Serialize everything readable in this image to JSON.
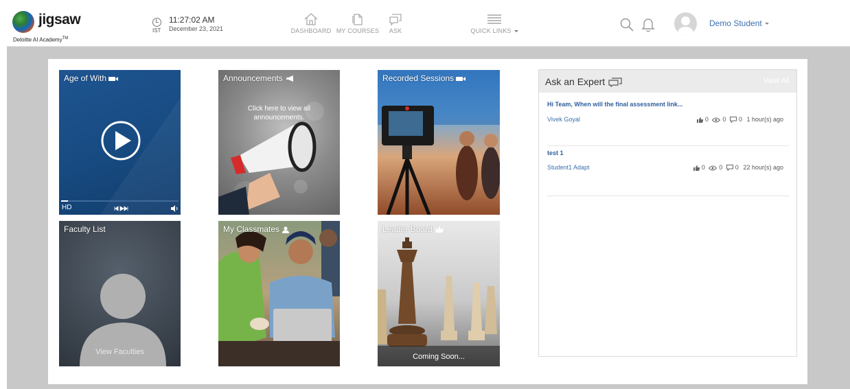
{
  "brand": {
    "name": "jigsaw",
    "tagline": "Deloitte AI Academy",
    "trademark": "TM"
  },
  "clock": {
    "time": "11:27:02 AM",
    "date": "December 23, 2021",
    "timezone": "IST"
  },
  "nav": {
    "dashboard": "DASHBOARD",
    "courses": "MY COURSES",
    "ask": "ASK",
    "quick_links": "QUICK LINKS"
  },
  "user": {
    "name": "Demo Student"
  },
  "tiles": {
    "age_of_with": {
      "title": "Age of With",
      "quality": "HD"
    },
    "announcements": {
      "title": "Announcements",
      "subtitle": "Click here to view all announcements."
    },
    "recorded": {
      "title": "Recorded Sessions"
    },
    "faculty": {
      "title": "Faculty List",
      "cta": "View Faculties"
    },
    "classmates": {
      "title": "My Classmates"
    },
    "leaderboard": {
      "title": "Leader Board",
      "cta": "Coming Soon..."
    }
  },
  "ask_expert": {
    "title": "Ask an Expert",
    "view_all": "View All",
    "questions": [
      {
        "title": "Hi Team, When will the final assessment link...",
        "author": "Vivek Goyal",
        "likes": "0",
        "views": "0",
        "comments": "0",
        "time": "1 hour(s) ago"
      },
      {
        "title": "test 1",
        "author": "Student1 Adapt",
        "likes": "0",
        "views": "0",
        "comments": "0",
        "time": "22 hour(s) ago"
      }
    ]
  },
  "colors": {
    "link": "#3b6fae",
    "frame": "#c8c8c8",
    "video_bg": "#1d4f86"
  }
}
